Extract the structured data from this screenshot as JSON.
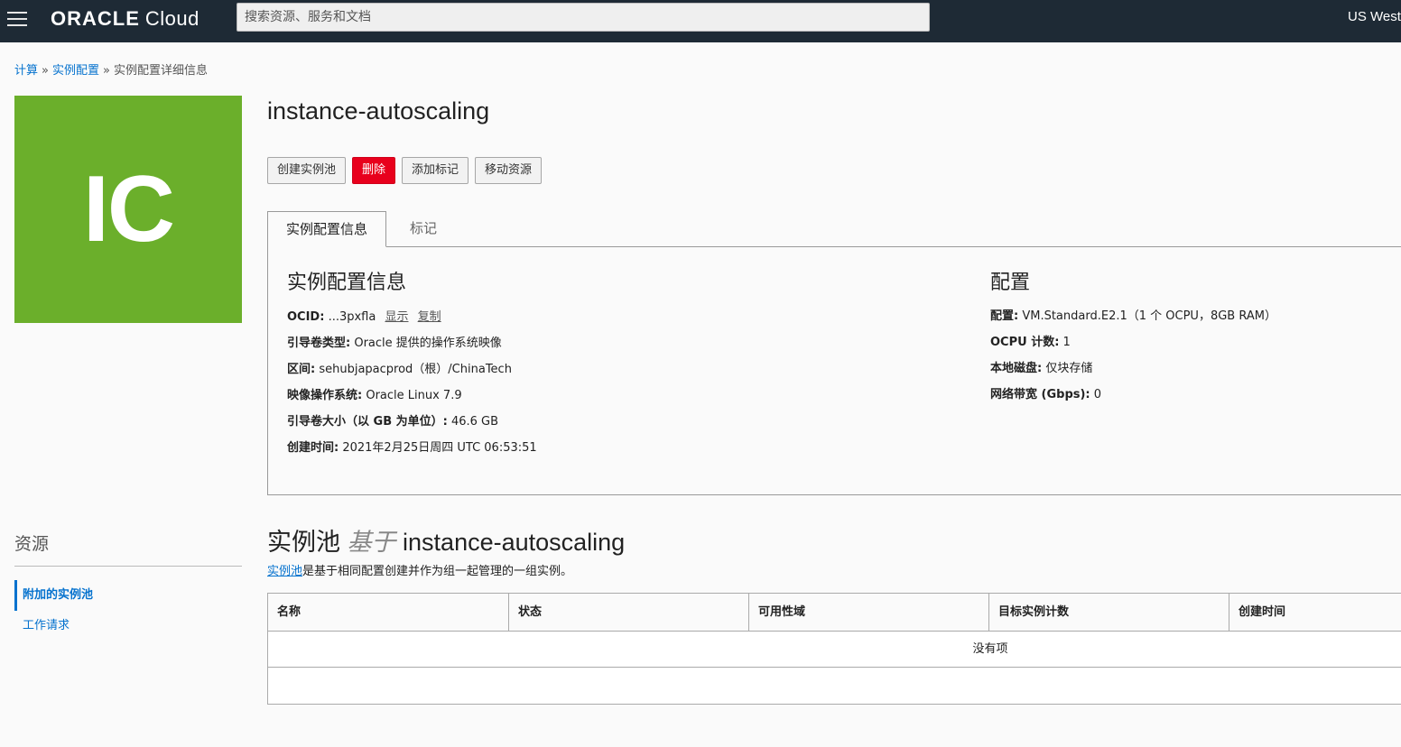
{
  "header": {
    "logo_brand": "ORACLE",
    "logo_product": "Cloud",
    "search_placeholder": "搜索资源、服务和文档",
    "region": "US West"
  },
  "breadcrumb": {
    "items": [
      "计算",
      "实例配置",
      "实例配置详细信息"
    ],
    "separator": "»"
  },
  "avatar": {
    "initials": "IC",
    "color": "#6baf2b"
  },
  "page": {
    "title": "instance-autoscaling"
  },
  "actions": {
    "create_pool": "创建实例池",
    "delete": "删除",
    "add_tags": "添加标记",
    "move_resource": "移动资源"
  },
  "tabs": {
    "info": "实例配置信息",
    "tags": "标记"
  },
  "info": {
    "left_heading": "实例配置信息",
    "ocid_label": "OCID:",
    "ocid_value": "...3pxfla",
    "show_link": "显示",
    "copy_link": "复制",
    "boot_volume_type_label": "引导卷类型:",
    "boot_volume_type_value": "Oracle 提供的操作系统映像",
    "compartment_label": "区间:",
    "compartment_value": "sehubjapacprod（根）/ChinaTech",
    "image_os_label": "映像操作系统:",
    "image_os_value": "Oracle Linux 7.9",
    "boot_volume_size_label": "引导卷大小（以 GB 为单位）:",
    "boot_volume_size_value": "46.6 GB",
    "created_label": "创建时间:",
    "created_value": "2021年2月25日周四 UTC 06:53:51",
    "right_heading": "配置",
    "shape_label": "配置:",
    "shape_value": "VM.Standard.E2.1（1 个 OCPU，8GB RAM）",
    "ocpu_label": "OCPU 计数:",
    "ocpu_value": "1",
    "local_disk_label": "本地磁盘:",
    "local_disk_value": "仅块存储",
    "bandwidth_label": "网络带宽 (Gbps):",
    "bandwidth_value": "0"
  },
  "resources": {
    "title": "资源",
    "items": [
      "附加的实例池",
      "工作请求"
    ]
  },
  "pool": {
    "title_prefix": "实例池",
    "title_based": "基于",
    "title_name": "instance-autoscaling",
    "desc_link": "实例池",
    "desc_rest": "是基于相同配置创建并作为组一起管理的一组实例。",
    "columns": [
      "名称",
      "状态",
      "可用性域",
      "目标实例计数",
      "创建时间"
    ],
    "empty_text": "没有项"
  }
}
